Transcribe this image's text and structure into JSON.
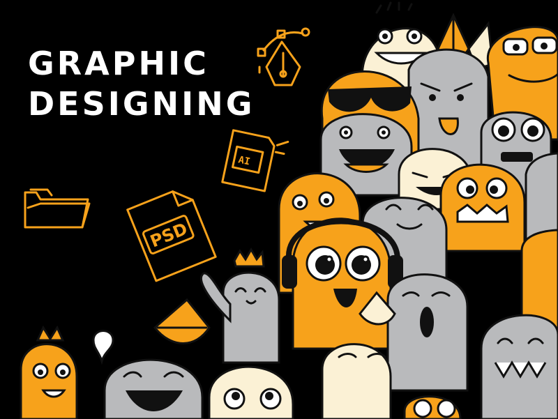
{
  "title": {
    "line1": "GRAPHIC",
    "line2": "DESIGNING"
  },
  "icons": {
    "folder": "folder-icon",
    "psd_file": "psd-file-icon",
    "ai_file": "ai-file-icon",
    "pen_tool": "pen-tool-icon"
  },
  "labels": {
    "psd": "PSD",
    "ai": "AI"
  },
  "colors": {
    "background": "#000000",
    "accent": "#F7A21B",
    "gray": "#B9BABC",
    "cream": "#FBF1D5",
    "white": "#FFFFFF"
  }
}
